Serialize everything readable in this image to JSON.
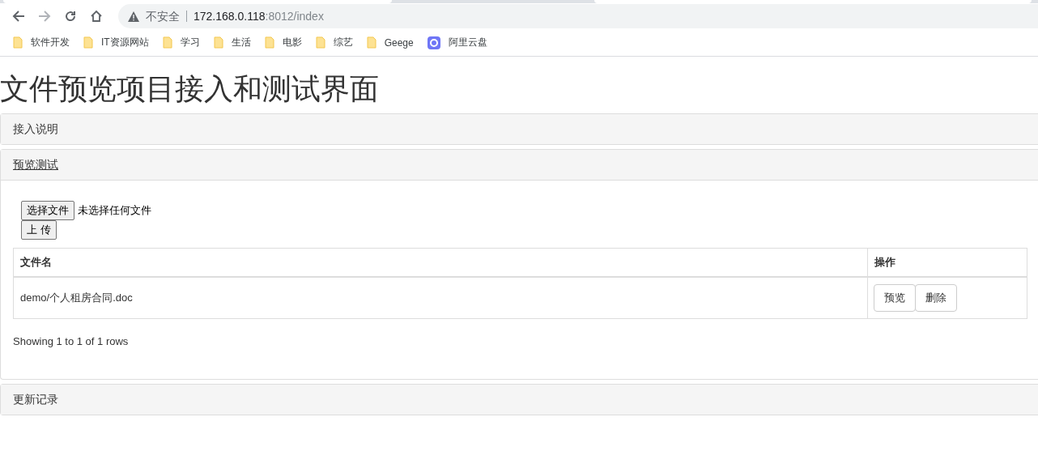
{
  "browser": {
    "nav": {
      "back_disabled": false,
      "forward_disabled": true
    },
    "security": "不安全",
    "url_host": "172.168.0.118",
    "url_path": ":8012/index",
    "bookmarks": [
      {
        "kind": "folder",
        "label": "软件开发"
      },
      {
        "kind": "folder",
        "label": "IT资源网站"
      },
      {
        "kind": "folder",
        "label": "学习"
      },
      {
        "kind": "folder",
        "label": "生活"
      },
      {
        "kind": "folder",
        "label": "电影"
      },
      {
        "kind": "folder",
        "label": "综艺"
      },
      {
        "kind": "folder",
        "label": "Geege"
      },
      {
        "kind": "app",
        "label": "阿里云盘"
      }
    ]
  },
  "page": {
    "title": "文件预览项目接入和测试界面",
    "panels": [
      {
        "heading": "接入说明",
        "expanded": false,
        "link": false
      },
      {
        "heading": "预览测试",
        "expanded": true,
        "link": true
      },
      {
        "heading": "更新记录",
        "expanded": false,
        "link": false
      }
    ],
    "upload": {
      "choose_button": "选择文件",
      "no_file": "未选择任何文件",
      "upload_button": "上 传"
    },
    "table": {
      "columns": [
        "文件名",
        "操作"
      ],
      "rows": [
        {
          "file": "demo/个人租房合同.doc",
          "actions": [
            "预览",
            "删除"
          ]
        }
      ]
    },
    "pagination": "Showing 1 to 1 of 1 rows"
  }
}
